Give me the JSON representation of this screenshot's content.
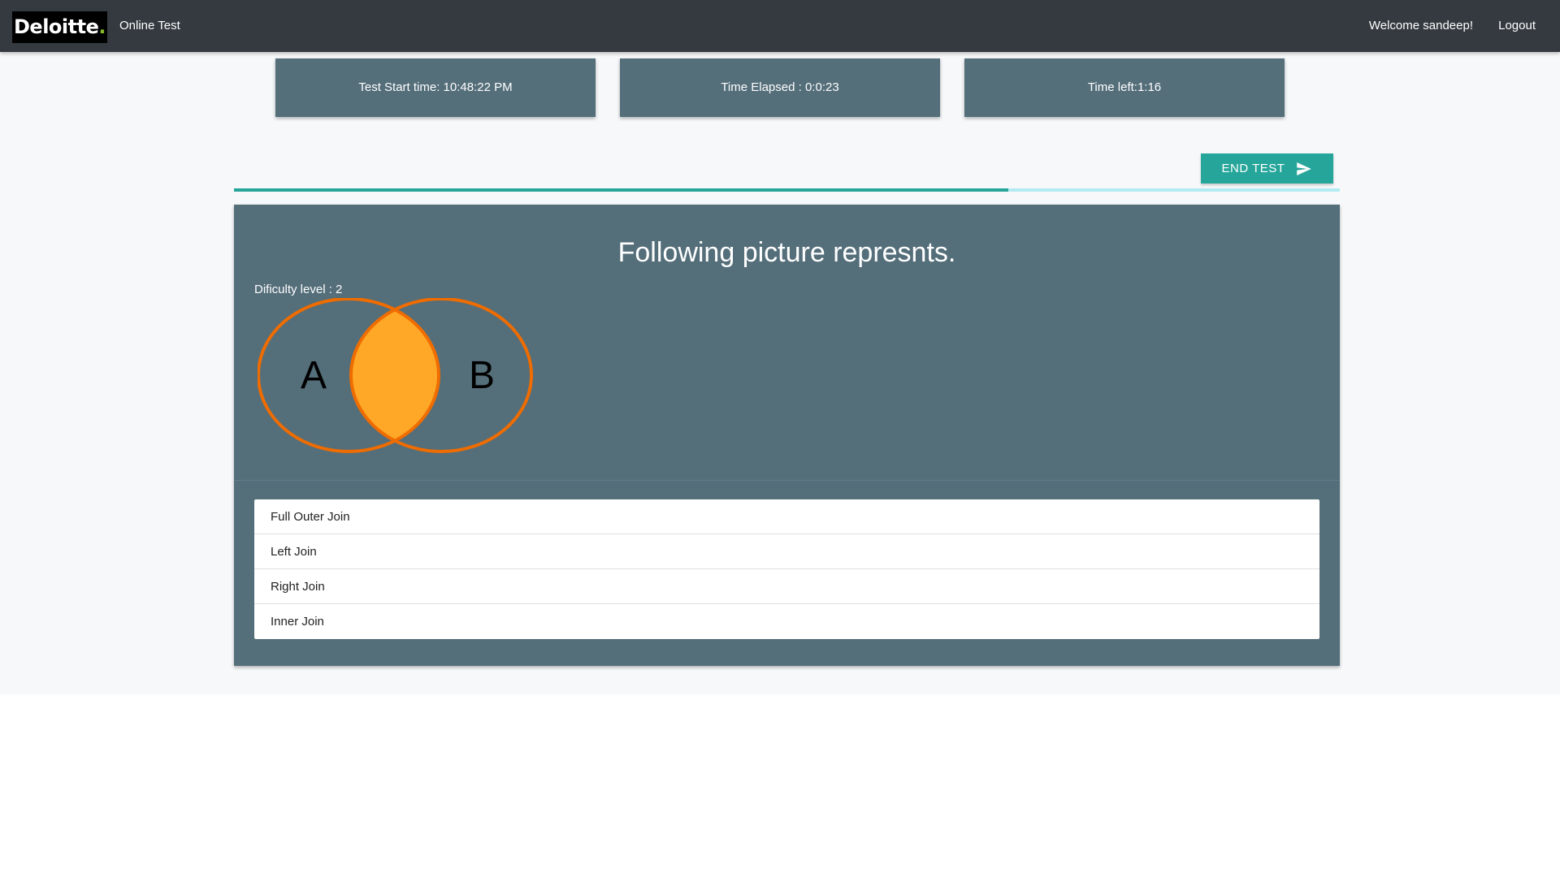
{
  "nav": {
    "logo_text": "Deloitte",
    "logo_dot": ".",
    "app_title": "Online Test",
    "welcome": "Welcome sandeep!",
    "logout": "Logout"
  },
  "timers": {
    "start": "Test Start time: 10:48:22 PM",
    "elapsed": "Time Elapsed : 0:0:23",
    "left": "Time left:1:16"
  },
  "actions": {
    "end_test": "END TEST"
  },
  "progress": {
    "fraction": 0.7
  },
  "question": {
    "title": "Following picture represnts.",
    "difficulty": "Dificulty level : 2",
    "venn": {
      "left_label": "A",
      "right_label": "B",
      "stroke_color": "#ef6c00",
      "fill_color": "#ffa726"
    },
    "options": [
      {
        "label": "Full Outer Join"
      },
      {
        "label": "Left Join"
      },
      {
        "label": "Right Join"
      },
      {
        "label": "Inner Join"
      }
    ]
  },
  "colors": {
    "navbar": "#343a40",
    "panel": "#546e7a",
    "accent": "#26a69a",
    "progress_track": "#b2ebf2"
  }
}
